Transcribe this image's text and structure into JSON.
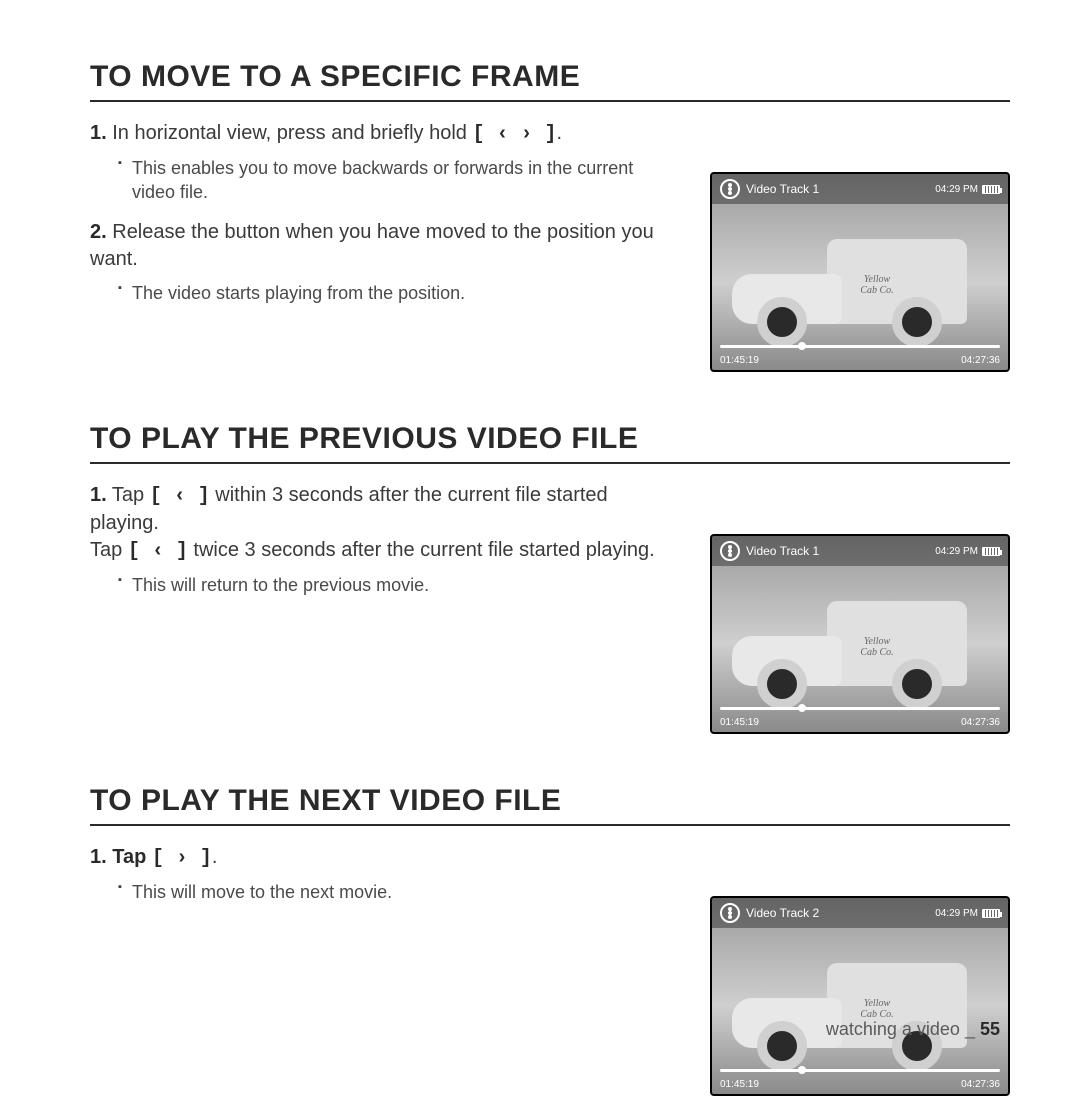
{
  "sections": [
    {
      "heading": "TO MOVE TO A SPECIFIC FRAME",
      "screen": {
        "track": "Video Track 1",
        "clock": "04:29 PM",
        "elapsed": "01:45:19",
        "total": "04:27:36",
        "door1": "Yellow",
        "door2": "Cab Co."
      },
      "steps": {
        "s1num": "1.",
        "s1a": " In horizontal view, press and briefly hold ",
        "s1key": "[ ‹  › ]",
        "s1b": ".",
        "s1bullet": "This enables you to move backwards or forwards in the current video file.",
        "s2num": "2.",
        "s2a": " Release the button when you have moved to the position you want.",
        "s2bullet": "The video starts playing from the position."
      }
    },
    {
      "heading": "TO PLAY THE PREVIOUS VIDEO FILE",
      "screen": {
        "track": "Video Track 1",
        "clock": "04:29 PM",
        "elapsed": "01:45:19",
        "total": "04:27:36",
        "door1": "Yellow",
        "door2": "Cab Co."
      },
      "steps": {
        "s1num": "1.",
        "s1a": " Tap ",
        "s1key": "[ ‹ ]",
        "s1b": " within 3 seconds after the current file started playing.",
        "s1c": "Tap ",
        "s1key2": "[ ‹ ]",
        "s1d": " twice 3 seconds after the current file started playing.",
        "s1bullet": "This will return to the previous movie."
      }
    },
    {
      "heading": "TO PLAY THE NEXT VIDEO FILE",
      "screen": {
        "track": "Video Track 2",
        "clock": "04:29 PM",
        "elapsed": "01:45:19",
        "total": "04:27:36",
        "door1": "Yellow",
        "door2": "Cab Co."
      },
      "steps": {
        "s1num": "1.",
        "s1a": " Tap ",
        "s1key": "[ › ]",
        "s1b": ".",
        "s1bullet": "This will move to the next movie."
      }
    }
  ],
  "footer": {
    "label": "watching a video _ ",
    "page": "55"
  }
}
